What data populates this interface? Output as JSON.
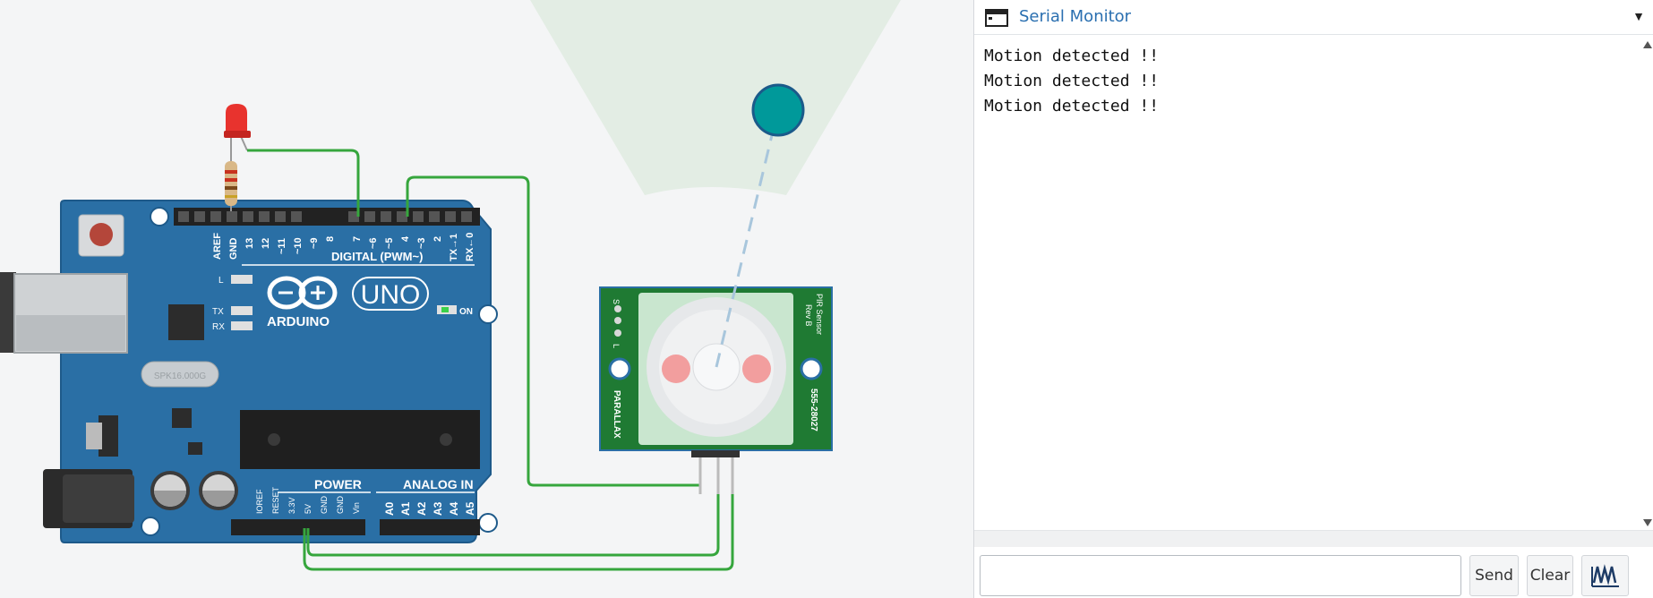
{
  "board": {
    "brand": "ARDUINO",
    "model": "UNO",
    "digital_header_label": "DIGITAL (PWM~)",
    "power_label": "POWER",
    "analog_label": "ANALOG IN",
    "on_label": "ON",
    "led_labels": [
      "L",
      "TX",
      "RX"
    ],
    "crystal_label": "SPK16.000G",
    "digital_pins": [
      "AREF",
      "GND",
      "13",
      "12",
      "~11",
      "~10",
      "~9",
      "8",
      "7",
      "~6",
      "~5",
      "4",
      "~3",
      "2",
      "TX→1",
      "RX←0"
    ],
    "power_pins": [
      "IOREF",
      "RESET",
      "3.3V",
      "5V",
      "GND",
      "GND",
      "Vin"
    ],
    "analog_pins": [
      "A0",
      "A1",
      "A2",
      "A3",
      "A4",
      "A5"
    ]
  },
  "pir_sensor": {
    "title": "PIR Sensor",
    "rev": "Rev B",
    "maker": "PARALLAX",
    "part_number": "555-28027",
    "pin_labels": [
      "S",
      "L"
    ]
  },
  "serial_monitor": {
    "title": "Serial Monitor",
    "collapse_icon": "triangle-down",
    "output_lines": [
      "Motion detected !!",
      "Motion detected !!",
      "Motion detected !!"
    ],
    "input_value": "",
    "send_label": "Send",
    "clear_label": "Clear",
    "graph_icon": "waveform-graph-icon"
  },
  "colors": {
    "board_blue": "#2a6fa5",
    "wire_green": "#36a63d",
    "sensor_green": "#1f7a33",
    "monitor_title": "#2a6fb0",
    "target_teal": "#00999a"
  }
}
